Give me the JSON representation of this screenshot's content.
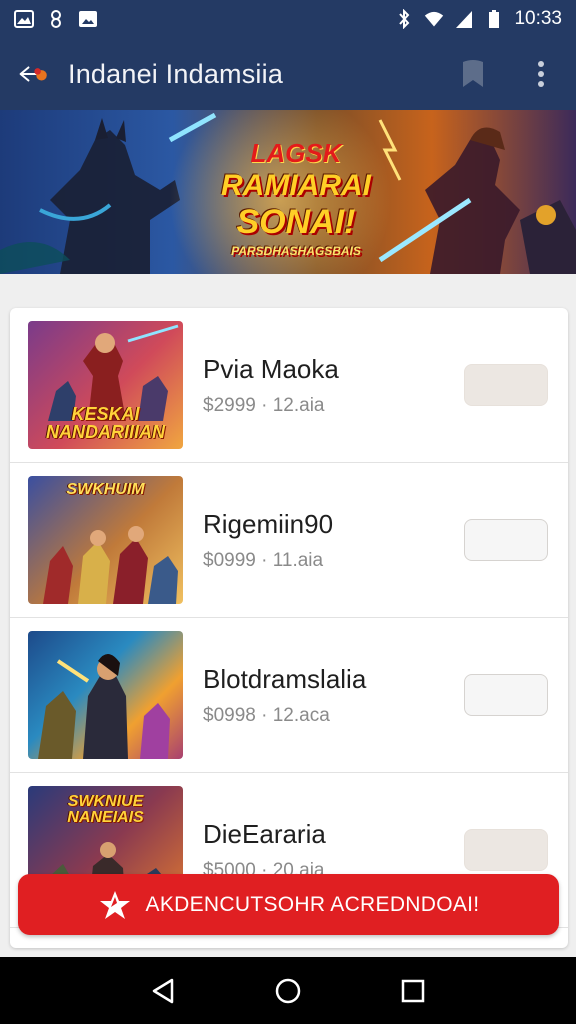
{
  "status_bar": {
    "time": "10:33",
    "left_icons": [
      "image-icon",
      "link-icon",
      "photo-icon"
    ],
    "right_icons": [
      "bluetooth-icon",
      "wifi-icon",
      "signal-icon",
      "battery-icon"
    ]
  },
  "app_bar": {
    "title": "Indanei Indamsiia",
    "back_icon": "back-arrow-icon",
    "actions": [
      "bookmark-icon",
      "more-vertical-icon"
    ]
  },
  "banner": {
    "line1": "LAGSK",
    "line2": "RAMIARAI",
    "line3": "SONAI!",
    "line4": "PARSDHASHAGSBAIS"
  },
  "items": [
    {
      "title": "Pvia Maoka",
      "subtitle": "$2999 · 12.aia",
      "thumb_caption": "KESKAI NANDARIIIAN",
      "button_tinted": true
    },
    {
      "title": "Rigemiin90",
      "subtitle": "$0999 · 11.aia",
      "thumb_caption": "SWKHUIM",
      "button_tinted": false
    },
    {
      "title": "Blotdramslalia",
      "subtitle": "$0998 · 12.aca",
      "thumb_caption": "",
      "button_tinted": false
    },
    {
      "title": "DieEararia",
      "subtitle": "$5000 · 20.aia",
      "thumb_caption": "SWKNIUE NANEIAIS",
      "button_tinted": true
    }
  ],
  "cta": {
    "label": "AKDENCUTSOHR ACREDNDOAI!",
    "icon": "star-icon"
  },
  "nav_bar": {
    "icons": [
      "back-triangle-icon",
      "home-circle-icon",
      "recents-square-icon"
    ]
  },
  "colors": {
    "app_bar": "#243a64",
    "cta": "#e01f22",
    "nav_bar": "#000000"
  }
}
